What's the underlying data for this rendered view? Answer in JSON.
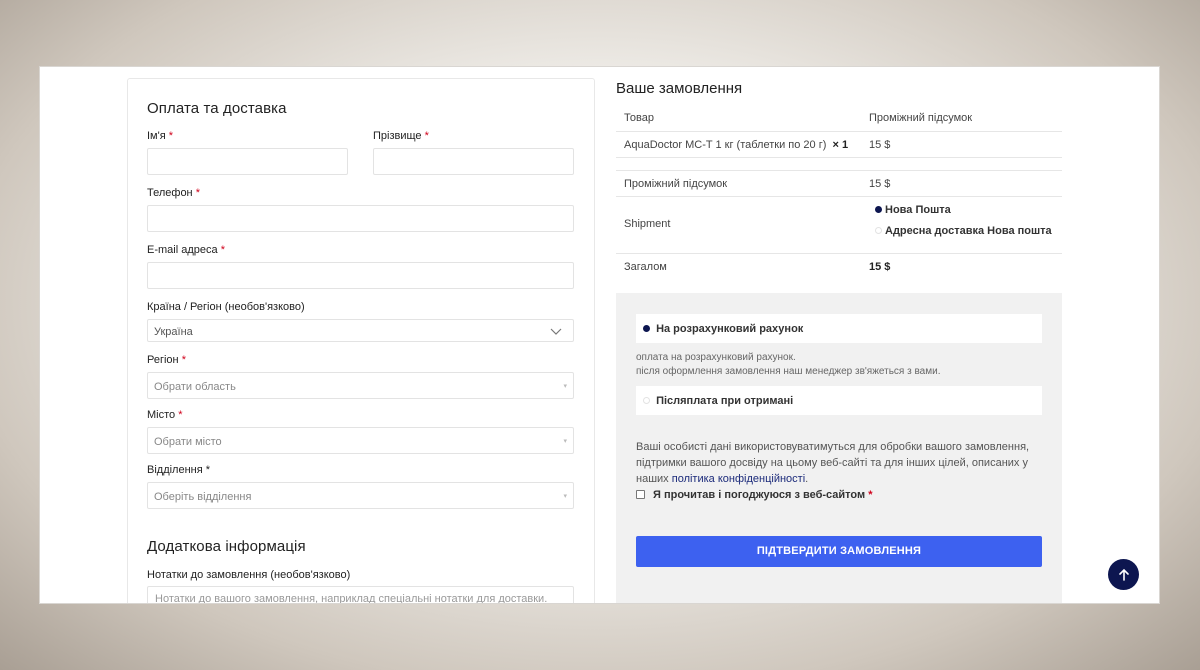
{
  "billing": {
    "title": "Оплата та доставка",
    "first_name_label": "Ім'я",
    "last_name_label": "Прізвище",
    "phone_label": "Телефон",
    "email_label": "E-mail адреса",
    "country_label": "Країна / Регіон (необов'язково)",
    "country_value": "Україна",
    "region_label": "Регіон",
    "region_placeholder": "Обрати область",
    "city_label": "Місто",
    "city_placeholder": "Обрати місто",
    "branch_label": "Відділення *",
    "branch_placeholder": "Оберіть відділення",
    "required_mark": "*"
  },
  "additional": {
    "title": "Додаткова інформація",
    "notes_label": "Нотатки до замовлення (необов'язково)",
    "notes_placeholder": "Нотатки до вашого замовлення, наприклад спеціальні нотатки для доставки."
  },
  "order": {
    "title": "Ваше замовлення",
    "col_product": "Товар",
    "col_subtotal": "Проміжний підсумок",
    "item_name": "AquaDoctor MC-T 1 кг (таблетки по 20 г)",
    "item_qty": "× 1",
    "item_price": "15 $",
    "subtotal_label": "Проміжний підсумок",
    "subtotal_value": "15 $",
    "shipment_label": "Shipment",
    "shipping_options": [
      "Нова Пошта",
      "Адресна доставка Нова пошта"
    ],
    "total_label": "Загалом",
    "total_value": "15 $"
  },
  "payment": {
    "option_bank": "На розрахунковий рахунок",
    "bank_desc_line1": "оплата на розрахунковий рахунок.",
    "bank_desc_line2": "після оформлення замовлення наш менеджер зв'яжеться з вами.",
    "option_cod": "Післяплата при отримані",
    "privacy_text": "Ваші особисті дані використовуватимуться для обробки вашого замовлення, підтримки вашого досвіду на цьому веб-сайті та для інших цілей, описаних у наших",
    "privacy_link": "політика конфіденційності",
    "privacy_end": ".",
    "agree_label": "Я прочитав і погоджуюся з веб-сайтом",
    "submit_label": "ПІДТВЕРДИТИ ЗАМОВЛЕННЯ"
  },
  "colors": {
    "accent": "#3d61f0",
    "dark_navy": "#0d1650",
    "required": "#d0021b"
  },
  "icons": {
    "scroll_top": "arrow-up-icon",
    "select_chevron": "chevron-down-icon"
  }
}
